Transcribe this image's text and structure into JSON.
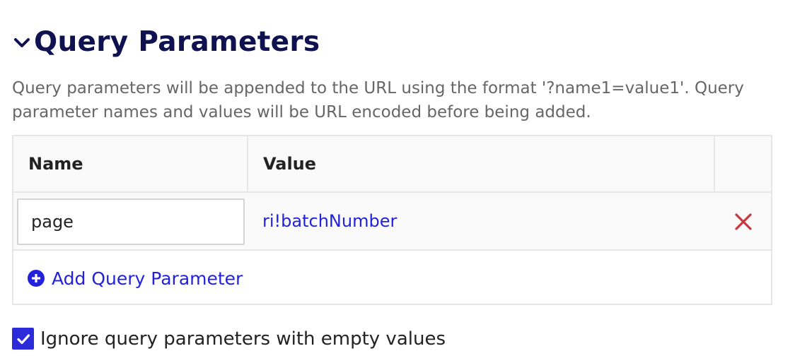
{
  "section": {
    "title": "Query Parameters",
    "expanded": true,
    "chevron_icon": "chevron-down-icon"
  },
  "description": "Query parameters will be appended to the URL using the format '?name1=value1'. Query parameter names and values will be URL encoded before being added.",
  "table": {
    "headers": {
      "name": "Name",
      "value": "Value"
    },
    "rows": [
      {
        "name": "page",
        "value": "ri!batchNumber",
        "delete_icon": "close-icon"
      }
    ],
    "add_label": "Add Query Parameter",
    "add_icon": "plus-circle-icon"
  },
  "ignore_empty": {
    "label": "Ignore query parameters with empty values",
    "checked": true,
    "check_icon": "check-icon"
  },
  "colors": {
    "title": "#101150",
    "description": "#666666",
    "link": "#2222dd",
    "delete": "#c8373b",
    "checkbox": "#2b2bd9",
    "border": "#e6e6e6",
    "row_background": "#fafafa"
  }
}
